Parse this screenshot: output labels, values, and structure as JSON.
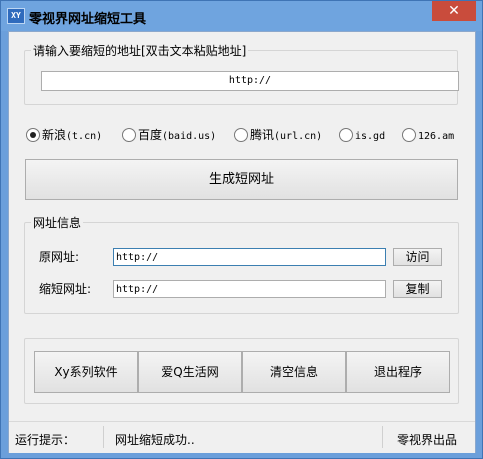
{
  "window": {
    "icon_text": "XY",
    "title": "零视界网址缩短工具",
    "close_glyph": "✕"
  },
  "input_group": {
    "label": "请输入要缩短的地址[双击文本粘贴地址]",
    "value": "http://"
  },
  "services": [
    {
      "name": "新浪",
      "domain": "(t.cn)",
      "selected": true
    },
    {
      "name": "百度",
      "domain": "(baid.us)",
      "selected": false
    },
    {
      "name": "腾讯",
      "domain": "(url.cn)",
      "selected": false
    },
    {
      "name": "",
      "domain": "is.gd",
      "selected": false
    },
    {
      "name": "",
      "domain": "126.am",
      "selected": false
    }
  ],
  "generate_button": "生成短网址",
  "info_group": {
    "label": "网址信息",
    "original_label": "原网址:",
    "original_value": "http://",
    "visit_button": "访问",
    "short_label": "缩短网址:",
    "short_value": "http://",
    "copy_button": "复制"
  },
  "bottom_buttons": [
    "Xy系列软件",
    "爱Q生活网",
    "清空信息",
    "退出程序"
  ],
  "status": {
    "label": "运行提示：",
    "message": "网址缩短成功..",
    "credit": "零视界出品"
  },
  "colors": {
    "title_bar": "#6fa4df",
    "close_button": "#c94c3c",
    "client_bg": "#f0f0f0"
  }
}
